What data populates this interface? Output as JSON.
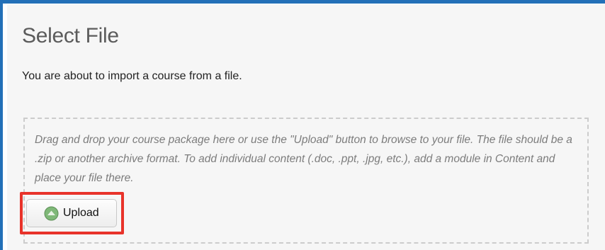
{
  "page": {
    "title": "Select File",
    "intro": "You are about to import a course from a file."
  },
  "dropzone": {
    "instructions": "Drag and drop your course package here or use the \"Upload\" button to browse to your file. The file should be a .zip or another archive format. To add individual content (.doc, .ppt, .jpg, etc.), add a module in Content and place your file there."
  },
  "upload_button": {
    "label": "Upload",
    "icon": "upload-arrow-icon"
  },
  "colors": {
    "frame_border": "#2370b8",
    "highlight_border": "#e8332a",
    "upload_icon": "#7fb878"
  }
}
